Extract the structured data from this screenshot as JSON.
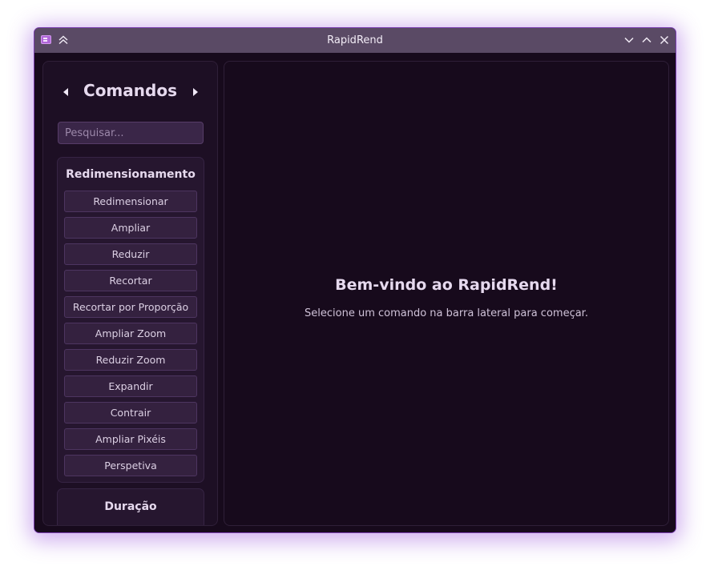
{
  "window": {
    "title": "RapidRend",
    "accent_color": "#7a3fb0",
    "background_color": "#170a1c",
    "titlebar_color": "#5a4a65",
    "icons": {
      "app": "app-icon",
      "keep_above": "keep-above-icon",
      "minimize": "minimize-icon",
      "maximize": "maximize-icon",
      "close": "close-icon"
    }
  },
  "sidebar": {
    "title": "Comandos",
    "prev_icon": "triangle-left-icon",
    "next_icon": "triangle-right-icon",
    "search": {
      "placeholder": "Pesquisar...",
      "value": ""
    },
    "groups": [
      {
        "title": "Redimensionamento",
        "commands": [
          "Redimensionar",
          "Ampliar",
          "Reduzir",
          "Recortar",
          "Recortar por Proporção",
          "Ampliar Zoom",
          "Reduzir Zoom",
          "Expandir",
          "Contrair",
          "Ampliar Pixéis",
          "Perspetiva"
        ]
      },
      {
        "title": "Duração",
        "commands": []
      }
    ]
  },
  "main": {
    "welcome_title": "Bem-vindo ao RapidRend!",
    "welcome_subtitle": "Selecione um comando na barra lateral para começar."
  }
}
